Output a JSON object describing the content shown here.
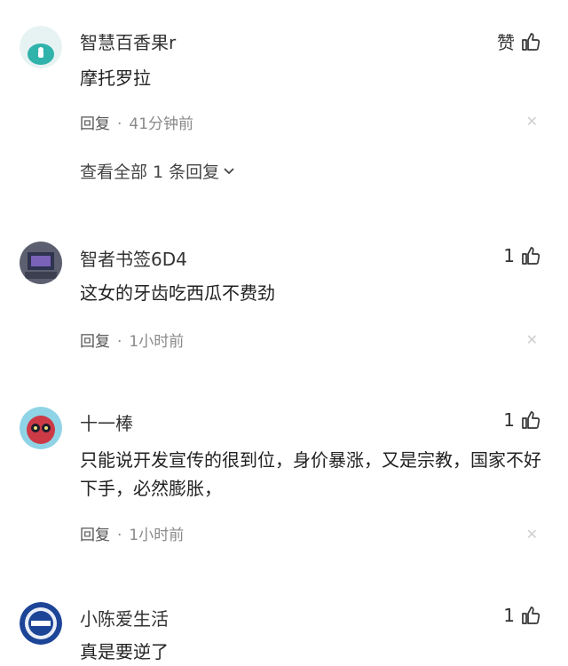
{
  "comments": [
    {
      "username": "智慧百香果r",
      "like_label": "赞",
      "text": "摩托罗拉",
      "reply_label": "回复",
      "time": "41分钟前",
      "view_replies": "查看全部 1 条回复",
      "avatar_color": "#33b8b0"
    },
    {
      "username": "智者书签6D4",
      "like_label": "1",
      "text": "这女的牙齿吃西瓜不费劲",
      "reply_label": "回复",
      "time": "1小时前",
      "avatar_color": "#4a4d63"
    },
    {
      "username": "十一棒",
      "like_label": "1",
      "text": "只能说开发宣传的很到位，身价暴涨，又是宗教，国家不好下手，必然膨胀，",
      "reply_label": "回复",
      "time": "1小时前",
      "avatar_color": "#c83a4a"
    },
    {
      "username": "小陈爱生活",
      "like_label": "1",
      "text": "真是要逆了",
      "avatar_color": "#1a3f8c"
    }
  ],
  "icons": {
    "like": "thumbs-up-icon",
    "close": "close-icon",
    "expand": "chevron-down-icon"
  }
}
